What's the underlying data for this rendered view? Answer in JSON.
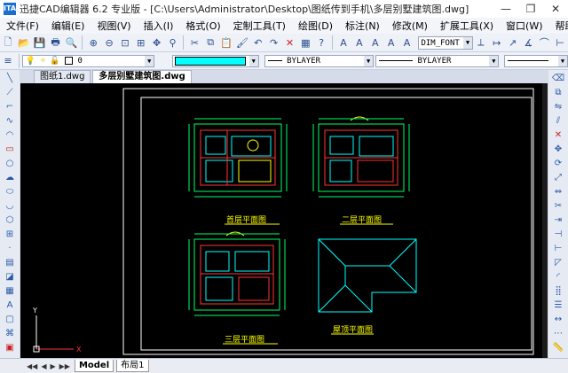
{
  "window": {
    "title": "迅捷CAD编辑器 6.2 专业版 - [C:\\Users\\Administrator\\Desktop\\图纸传到手机\\多层别墅建筑图.dwg]",
    "logo": "ITA",
    "min": "—",
    "max": "❐",
    "close": "✕"
  },
  "menu": [
    "文件(F)",
    "编辑(E)",
    "视图(V)",
    "插入(I)",
    "格式(O)",
    "定制工具(T)",
    "绘图(D)",
    "标注(N)",
    "修改(M)",
    "扩展工具(X)",
    "窗口(W)",
    "帮助(H)"
  ],
  "toolbar": {
    "font_combo": "DIM_FONT"
  },
  "props": {
    "layer": "0",
    "linetype1": "BYLAYER",
    "linetype2": "BYLAYER",
    "color_hex": "#00ffff"
  },
  "tabs": [
    "图纸1.dwg",
    "多层别墅建筑图.dwg"
  ],
  "drawing": {
    "labels": [
      "首层平面图",
      "二层平面图",
      "三层平面图",
      "屋顶平面图"
    ],
    "axis_x": "X",
    "axis_y": "Y"
  },
  "status": {
    "nav": [
      "◀◀",
      "◀",
      "▶",
      "▶▶"
    ],
    "model_tab": "Model",
    "layout_tab": "布局1"
  }
}
